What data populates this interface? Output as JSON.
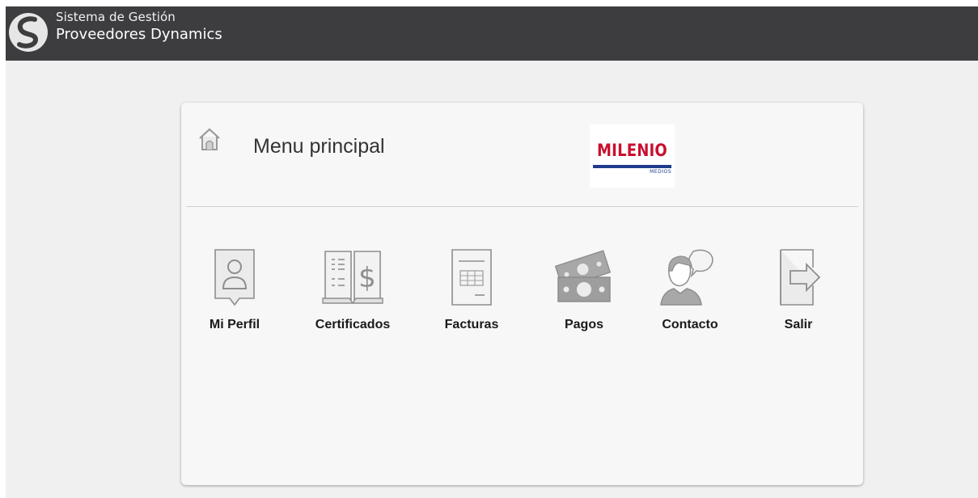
{
  "header": {
    "line1": "Sistema de Gestión",
    "line2": "Proveedores Dynamics",
    "background": "#3d3d40"
  },
  "card": {
    "title": "Menu principal",
    "logo": {
      "wordmark": "MILENIO",
      "sub": "MEDIOS",
      "red": "#c8102e",
      "blue": "#1f3b8c"
    }
  },
  "menu": [
    {
      "label": "Mi Perfil",
      "icon": "user-profile-icon"
    },
    {
      "label": "Certificados",
      "icon": "book-dollar-icon"
    },
    {
      "label": "Facturas",
      "icon": "invoice-document-icon"
    },
    {
      "label": "Pagos",
      "icon": "money-bills-icon"
    },
    {
      "label": "Contacto",
      "icon": "contact-chat-icon"
    },
    {
      "label": "Salir",
      "icon": "exit-arrow-icon"
    }
  ]
}
